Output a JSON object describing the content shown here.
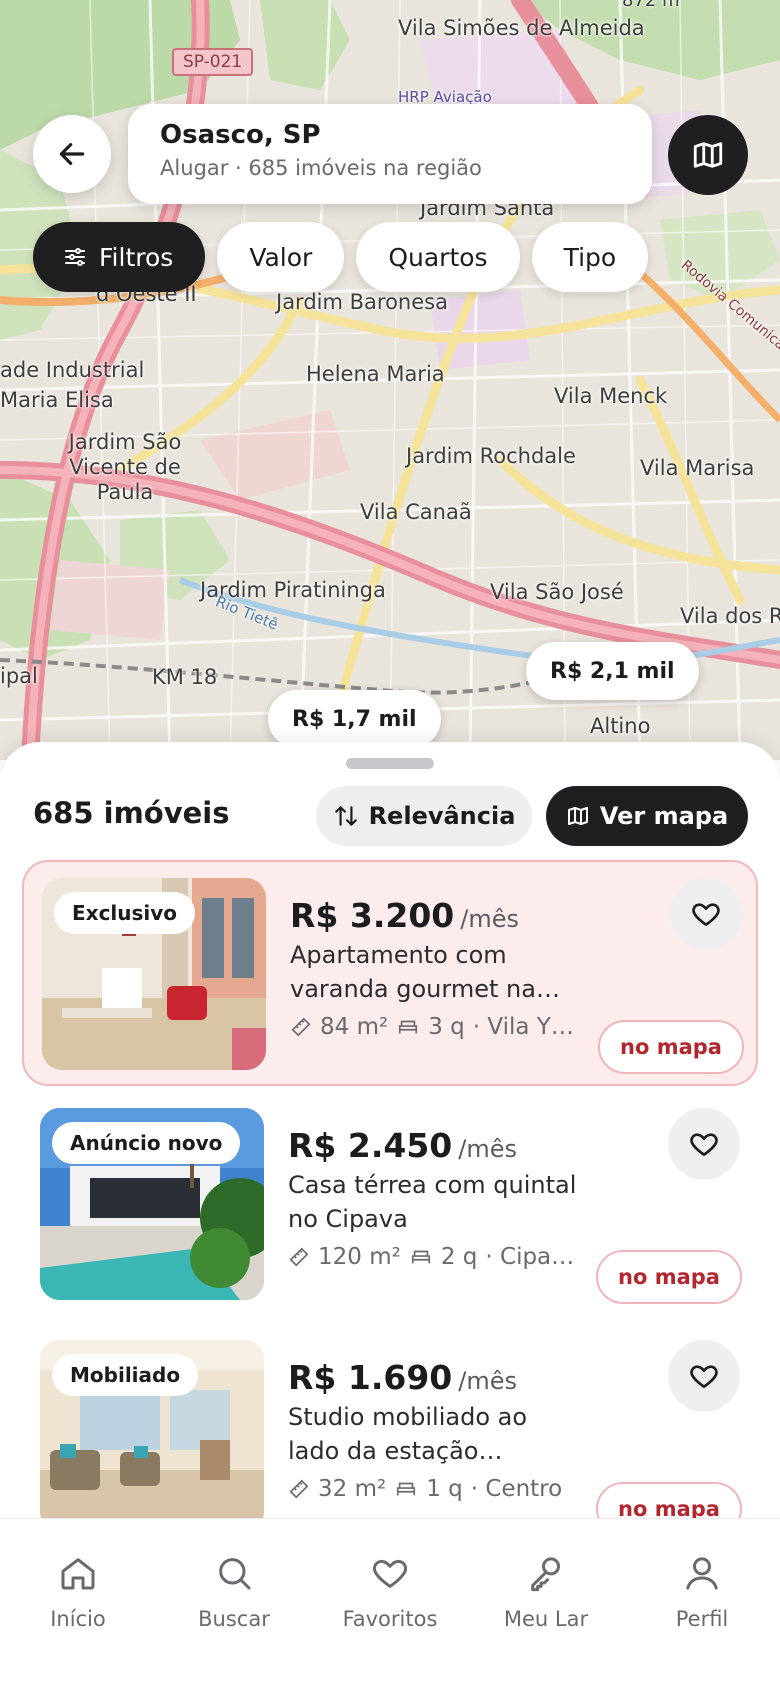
{
  "map": {
    "labels": [
      "Vila Simões de Almeida",
      "Jardim Santa",
      "Jardim Baronesa",
      "Helena Maria",
      "Vila Menck",
      "Jardim Rochdale",
      "Vila Marisa",
      "Vila Canaã",
      "Jardim Piratininga",
      "Vila São José",
      "Vila dos R",
      "Jardim São Vicente de Paula",
      "ade Industrial",
      "Maria Elisa",
      "KM 18",
      "Altino",
      "Rio Tietê",
      "Rodovia Comunicador Silvio",
      "HRP Aviação",
      "872 m",
      "d Oeste II",
      "ipal"
    ],
    "road_tag": "SP-021",
    "price_pins": [
      "R$ 2,1 mil",
      "R$ 1,7 mil"
    ]
  },
  "search": {
    "title": "Osasco, SP",
    "subtitle": "Alugar · 685 imóveis na região"
  },
  "filters": {
    "main": "Filtros",
    "chips": [
      "Valor",
      "Quartos",
      "Tipo"
    ]
  },
  "results": {
    "count": "685 imóveis",
    "sort_label": "Relevância",
    "view_map_label": "Ver mapa"
  },
  "listings": [
    {
      "badge": "Exclusivo",
      "price": "R$ 3.200",
      "period": "/mês",
      "description": "Apartamento com varanda gourmet na…",
      "area": "84 m²",
      "rooms": "3 q",
      "location": "· Vila Y…",
      "map_button": "no mapa",
      "highlighted": true
    },
    {
      "badge": "Anúncio novo",
      "price": "R$ 2.450",
      "period": "/mês",
      "description": "Casa térrea com quintal no Cipava",
      "area": "120 m²",
      "rooms": "2 q",
      "location": "· Cipa…",
      "map_button": "no mapa",
      "highlighted": false
    },
    {
      "badge": "Mobiliado",
      "price": "R$ 1.690",
      "period": "/mês",
      "description": "Studio mobiliado ao lado da estação…",
      "area": "32 m²",
      "rooms": "1 q",
      "location": "· Centro",
      "map_button": "no mapa",
      "highlighted": false
    }
  ],
  "nav": {
    "items": [
      {
        "label": "Início",
        "icon": "home-icon"
      },
      {
        "label": "Buscar",
        "icon": "search-icon"
      },
      {
        "label": "Favoritos",
        "icon": "heart-icon"
      },
      {
        "label": "Meu Lar",
        "icon": "key-icon"
      },
      {
        "label": "Perfil",
        "icon": "user-icon"
      }
    ]
  },
  "colors": {
    "accent": "#b3262e",
    "dark": "#1f1f22",
    "highlight_bg": "#fcecec"
  }
}
